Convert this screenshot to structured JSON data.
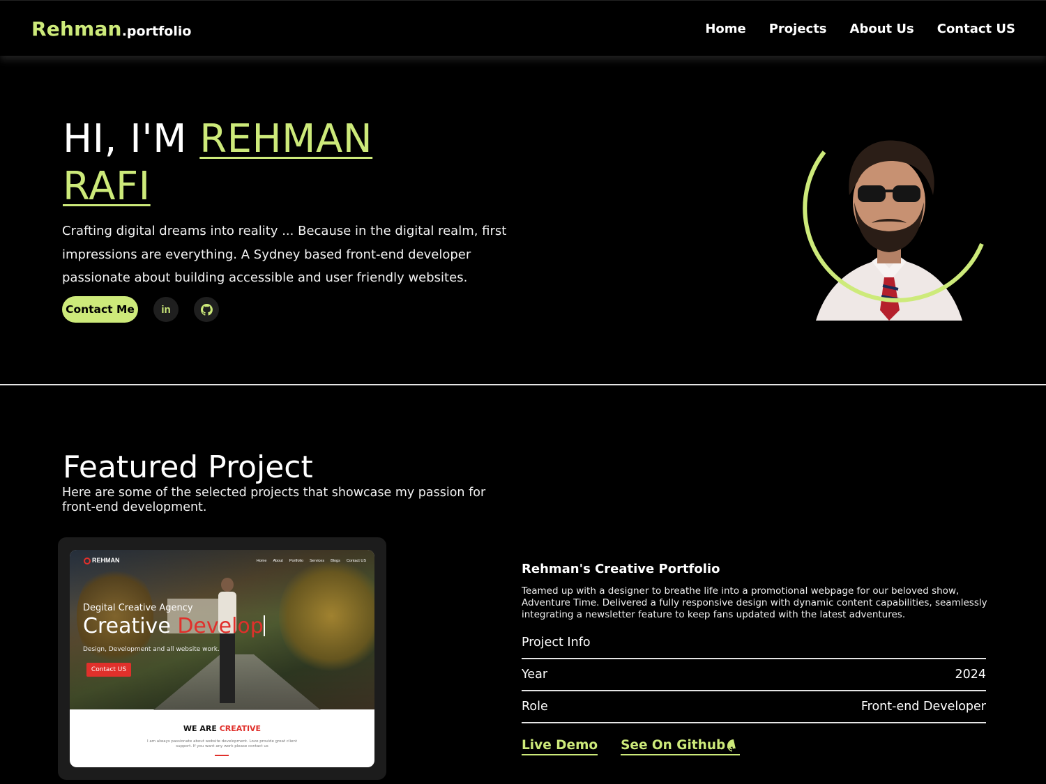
{
  "brand": {
    "main": "Rehman",
    "sub": ".portfolio"
  },
  "nav": {
    "links": [
      "Home",
      "Projects",
      "About Us",
      "Contact US"
    ]
  },
  "hero": {
    "greeting": "HI, I'M",
    "name": "REHMAN RAFI",
    "description": "Crafting digital dreams into reality ... Because in the digital realm, first impressions are everything. A Sydney based front-end developer passionate about building accessible and user friendly websites.",
    "contact_button": "Contact Me",
    "linkedin_label": "in"
  },
  "featured": {
    "title": "Featured Project",
    "subtitle": "Here are some of the selected projects that showcase my passion for front-end development."
  },
  "preview": {
    "logo": "REHMAN",
    "nav": [
      "Home",
      "About",
      "Portfolio",
      "Services",
      "Blogs",
      "Contact US"
    ],
    "kicker": "Degital Creative Agency",
    "headline_white": "Creative",
    "headline_red": "Develop",
    "tagline": "Design, Development and all website work.",
    "button": "Contact US",
    "we_are": "WE ARE",
    "we_are_red": "CREATIVE",
    "paragraph": "I am always passionate about website development. Love provide great client support. If you want any work please contact us"
  },
  "project": {
    "name": "Rehman's Creative Portfolio",
    "description": "Teamed up with a designer to breathe life into a promotional webpage for our beloved show, Adventure Time. Delivered a fully responsive design with dynamic content capabilities, seamlessly integrating a newsletter feature to keep fans updated with the latest adventures.",
    "info_label": "Project Info",
    "rows": [
      {
        "label": "Year",
        "value": "2024"
      },
      {
        "label": "Role",
        "value": "Front-end Developer"
      }
    ],
    "live_demo": "Live Demo",
    "github": "See On Github"
  },
  "colors": {
    "accent": "#cdea7a",
    "background": "#000000",
    "preview_red": "#e0302b"
  },
  "icons": {
    "linkedin": "linkedin-icon",
    "github": "github-icon"
  }
}
